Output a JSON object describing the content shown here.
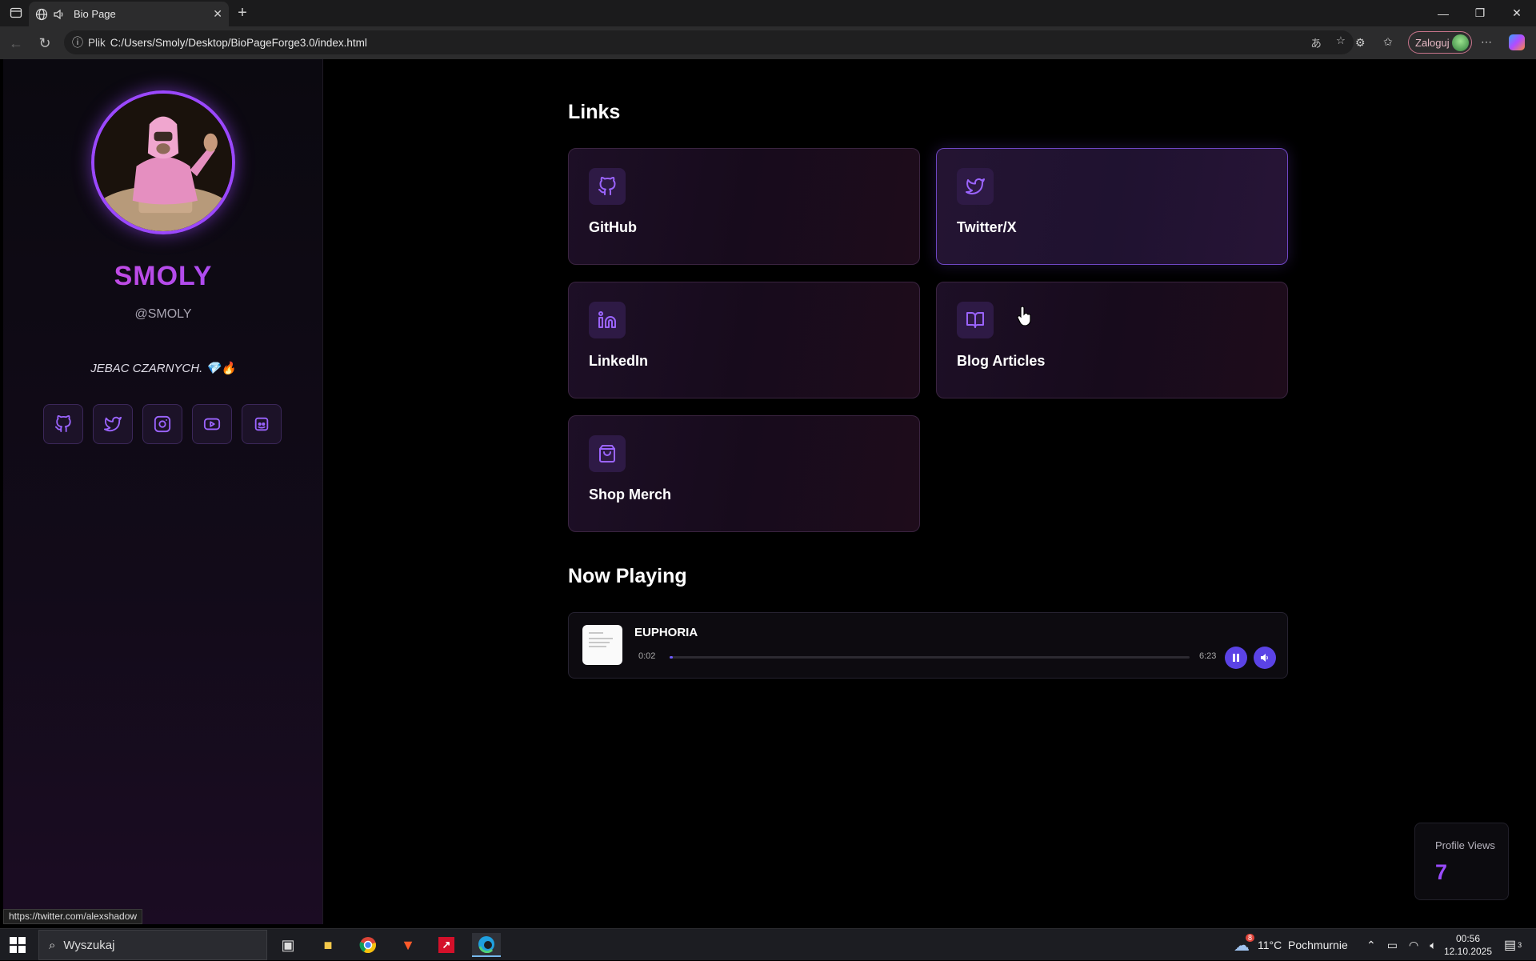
{
  "browser": {
    "tab_title": "Bio Page",
    "url_scheme_label": "Plik",
    "url": "C:/Users/Smoly/Desktop/BioPageForge3.0/index.html",
    "profile_label": "Zaloguj",
    "status_url": "https://twitter.com/alexshadow"
  },
  "profile": {
    "name": "SMOLY",
    "handle": "@SMOLY",
    "bio": "JEBAC CZARNYCH. 💎🔥",
    "socials": [
      {
        "icon": "github-icon"
      },
      {
        "icon": "twitter-icon"
      },
      {
        "icon": "instagram-icon"
      },
      {
        "icon": "youtube-icon"
      },
      {
        "icon": "discord-icon"
      }
    ]
  },
  "links": {
    "title": "Links",
    "items": [
      {
        "label": "GitHub",
        "icon": "github-icon"
      },
      {
        "label": "Twitter/X",
        "icon": "twitter-icon"
      },
      {
        "label": "LinkedIn",
        "icon": "linkedin-icon"
      },
      {
        "label": "Blog Articles",
        "icon": "book-icon"
      },
      {
        "label": "Shop Merch",
        "icon": "shopping-bag-icon"
      }
    ]
  },
  "now_playing": {
    "title": "Now Playing",
    "track": "EUPHORIA",
    "elapsed": "0:02",
    "duration": "6:23",
    "progress_fraction": 0.005
  },
  "views": {
    "label": "Profile Views",
    "count": "7"
  },
  "taskbar": {
    "search_placeholder": "Wyszukaj",
    "weather": "11°C  Pochmurnie",
    "weather_badge": "8",
    "time": "00:56",
    "date": "12.10.2025",
    "notifications": "3"
  },
  "colors": {
    "accent": "#9b48ff",
    "name_gradient_start": "#d34bd6",
    "name_gradient_end": "#9a4bff",
    "player_accent": "#5b43e6"
  }
}
